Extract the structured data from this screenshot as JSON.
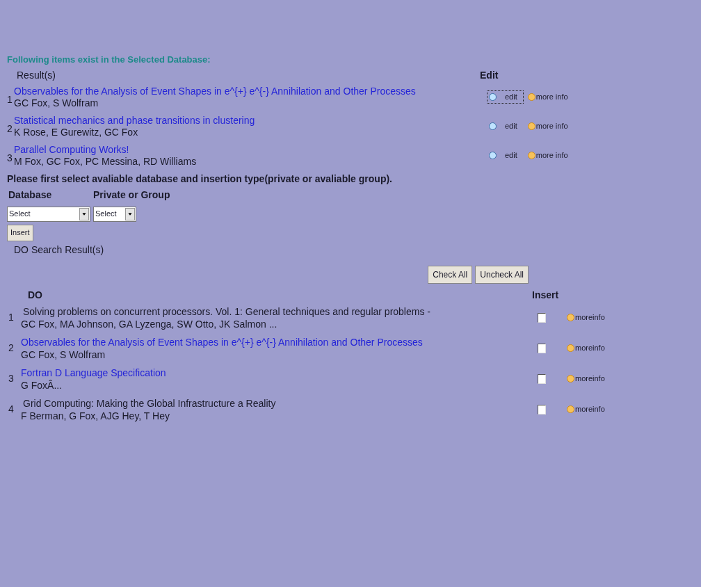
{
  "heading": "Following items exist in the Selected Database:",
  "results": {
    "columns": [
      "Result(s)",
      "Edit"
    ],
    "rows": [
      {
        "number": "1",
        "title": "Observables for the Analysis of Event Shapes in e^{+} e^{-} Annihilation and Other Processes",
        "authors": "GC Fox, S Wolfram",
        "edit": "edit",
        "more": "more info",
        "focused": true
      },
      {
        "number": "2",
        "title": "Statistical mechanics and phase transitions in clustering",
        "authors": "K Rose, E Gurewitz, GC Fox",
        "edit": "edit",
        "more": "more info",
        "focused": false
      },
      {
        "number": "3",
        "title": "Parallel Computing Works!",
        "authors": "M Fox, GC Fox, PC Messina, RD Williams",
        "edit": "edit",
        "more": "more info",
        "focused": false
      }
    ]
  },
  "instruction": "Please first select avaliable database and insertion type(private or avaliable group).",
  "selectors": [
    {
      "label": "Database",
      "value": "Select"
    },
    {
      "label": "Private or Group",
      "value": "Select"
    }
  ],
  "insert_button": "Insert",
  "do_title": "DO Search Result(s)",
  "check_buttons": [
    "Check All",
    "Uncheck All"
  ],
  "do": {
    "columns": [
      "DO",
      "Insert"
    ],
    "rows": [
      {
        "number": "1",
        "title": "Solving problems on concurrent processors. Vol. 1: General techniques and regular problems -",
        "authors": "GC Fox, MA Johnson, GA Lyzenga, SW Otto, JK Salmon ...",
        "link": false,
        "checked": false,
        "more": "moreinfo"
      },
      {
        "number": "2",
        "title": "Observables for the Analysis of Event Shapes in e^{+} e^{-} Annihilation and Other Processes",
        "authors": "GC Fox, S Wolfram",
        "link": true,
        "checked": false,
        "more": "moreinfo"
      },
      {
        "number": "3",
        "title": "Fortran D Language Specification",
        "authors": "G FoxÂ...",
        "link": true,
        "checked": false,
        "more": "moreinfo"
      },
      {
        "number": "4",
        "title": "Grid Computing: Making the Global Infrastructure a Reality",
        "authors": "F Berman, G Fox, AJG Hey, T Hey",
        "link": false,
        "checked": false,
        "more": "moreinfo"
      }
    ]
  }
}
